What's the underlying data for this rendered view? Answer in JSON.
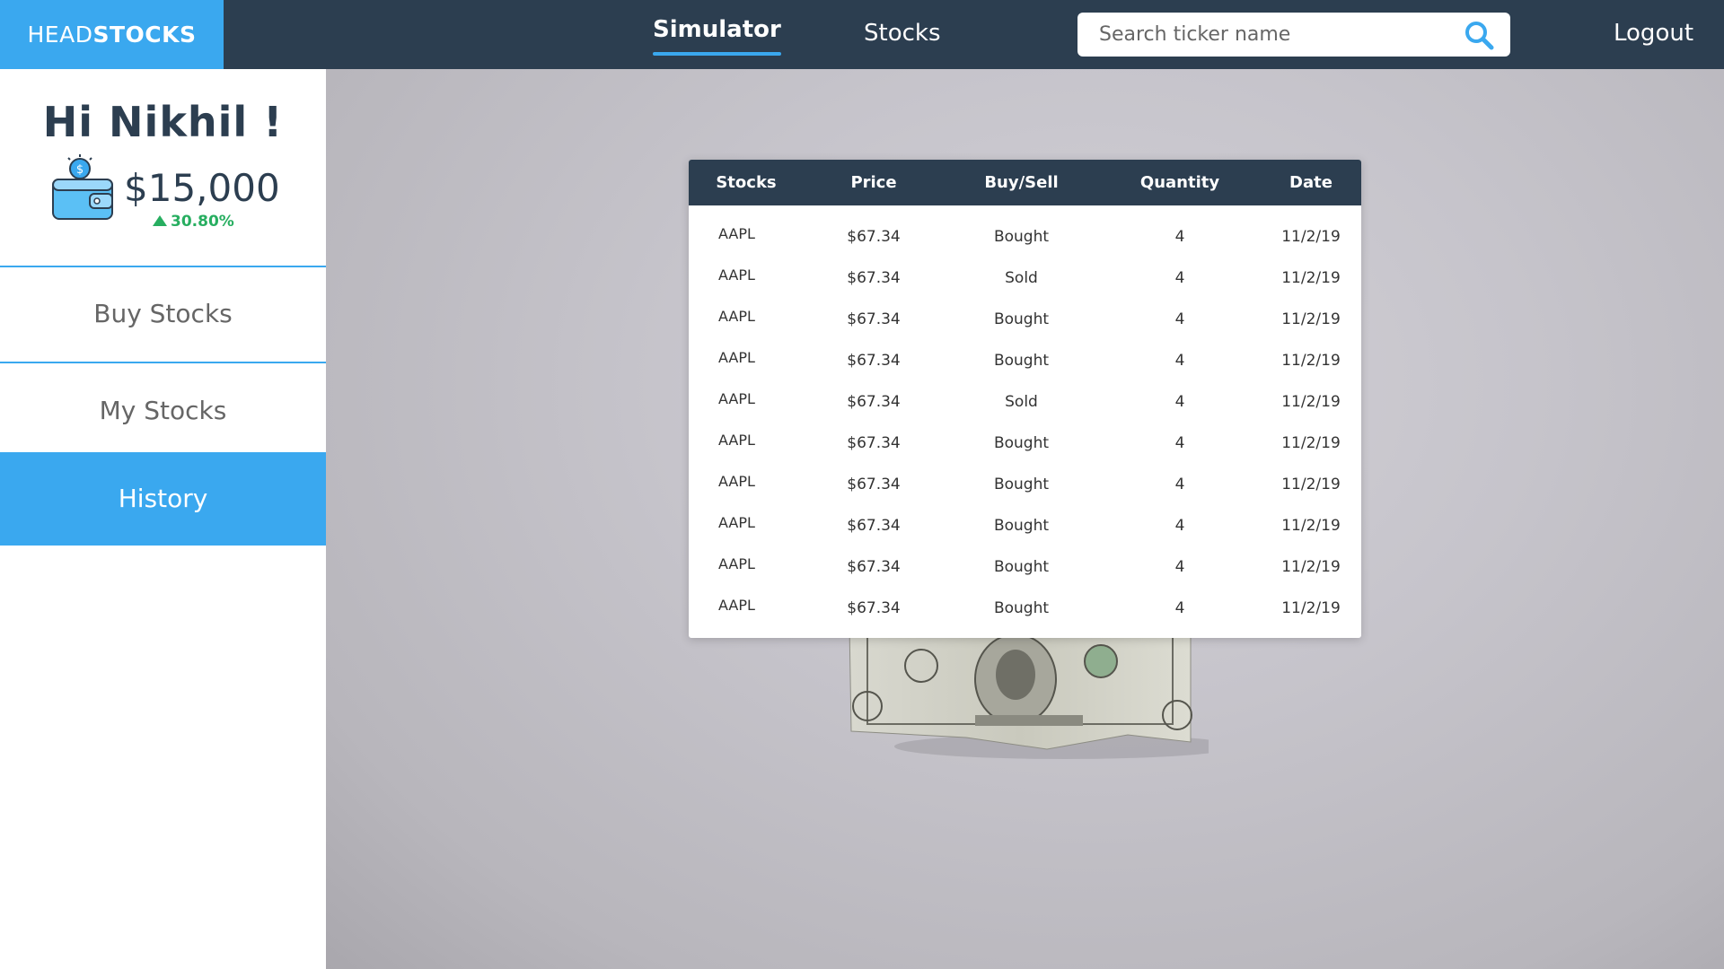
{
  "app": {
    "logo_light": "HEAD",
    "logo_bold": "STOCKS",
    "nav": {
      "simulator": "Simulator",
      "stocks": "Stocks"
    },
    "search_placeholder": "Search ticker name",
    "logout": "Logout"
  },
  "sidebar": {
    "greeting": "Hi Nikhil !",
    "balance": "$15,000",
    "change": "30.80%",
    "items": [
      {
        "label": "Buy Stocks",
        "active": false
      },
      {
        "label": "My Stocks",
        "active": false
      },
      {
        "label": "History",
        "active": true
      }
    ]
  },
  "history": {
    "columns": [
      "Stocks",
      "Price",
      "Buy/Sell",
      "Quantity",
      "Date"
    ],
    "rows": [
      [
        "AAPL",
        "$67.34",
        "Bought",
        "4",
        "11/2/19"
      ],
      [
        "AAPL",
        "$67.34",
        "Sold",
        "4",
        "11/2/19"
      ],
      [
        "AAPL",
        "$67.34",
        "Bought",
        "4",
        "11/2/19"
      ],
      [
        "AAPL",
        "$67.34",
        "Bought",
        "4",
        "11/2/19"
      ],
      [
        "AAPL",
        "$67.34",
        "Sold",
        "4",
        "11/2/19"
      ],
      [
        "AAPL",
        "$67.34",
        "Bought",
        "4",
        "11/2/19"
      ],
      [
        "AAPL",
        "$67.34",
        "Bought",
        "4",
        "11/2/19"
      ],
      [
        "AAPL",
        "$67.34",
        "Bought",
        "4",
        "11/2/19"
      ],
      [
        "AAPL",
        "$67.34",
        "Bought",
        "4",
        "11/2/19"
      ],
      [
        "AAPL",
        "$67.34",
        "Bought",
        "4",
        "11/2/19"
      ]
    ]
  },
  "colors": {
    "navy": "#2c3e50",
    "accent": "#3aa8ef",
    "positive": "#27ae60"
  },
  "icons": {
    "search": "search-icon",
    "wallet": "wallet-icon",
    "up": "triangle-up-icon"
  }
}
